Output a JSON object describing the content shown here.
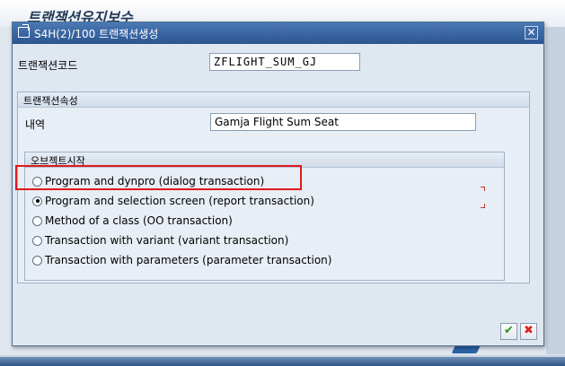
{
  "background": {
    "title": "트랜잭션유지보수"
  },
  "dialog": {
    "title": "S4H(2)/100 트랜잭션생성",
    "close_label": "✕",
    "transaction_code_label": "트랜잭션코드",
    "transaction_code_value": "ZFLIGHT_SUM_GJ",
    "attributes_group_title": "트랜잭션속성",
    "description_label": "내역",
    "description_value": "Gamja Flight Sum Seat",
    "start_object_group_title": "오브젝트시작",
    "options": [
      {
        "label": "Program and dynpro (dialog transaction)",
        "checked": false
      },
      {
        "label": "Program and selection screen (report transaction)",
        "checked": true
      },
      {
        "label": "Method of a class (OO transaction)",
        "checked": false
      },
      {
        "label": "Transaction with variant (variant transaction)",
        "checked": false
      },
      {
        "label": "Transaction with parameters (parameter transaction)",
        "checked": false
      }
    ],
    "ok_label": "✔",
    "cancel_label": "✖"
  },
  "colors": {
    "titlebar": "#2a5591",
    "highlight": "#e01919",
    "ok": "#1f9a1f",
    "cancel": "#dd2222"
  }
}
